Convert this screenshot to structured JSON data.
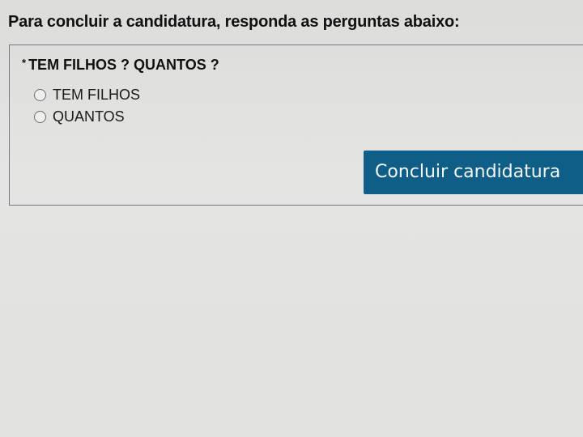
{
  "form": {
    "instruction": "Para concluir a candidatura, responda as perguntas abaixo:",
    "question": {
      "required_mark": "*",
      "title": "TEM FILHOS ? QUANTOS ?",
      "options": [
        {
          "label": "TEM FILHOS",
          "selected": false
        },
        {
          "label": "QUANTOS",
          "selected": false
        }
      ]
    },
    "submit_label": "Concluir candidatura"
  },
  "colors": {
    "button_bg": "#0f5e87",
    "button_text": "#f4f7f9",
    "border": "#6e7a80"
  }
}
